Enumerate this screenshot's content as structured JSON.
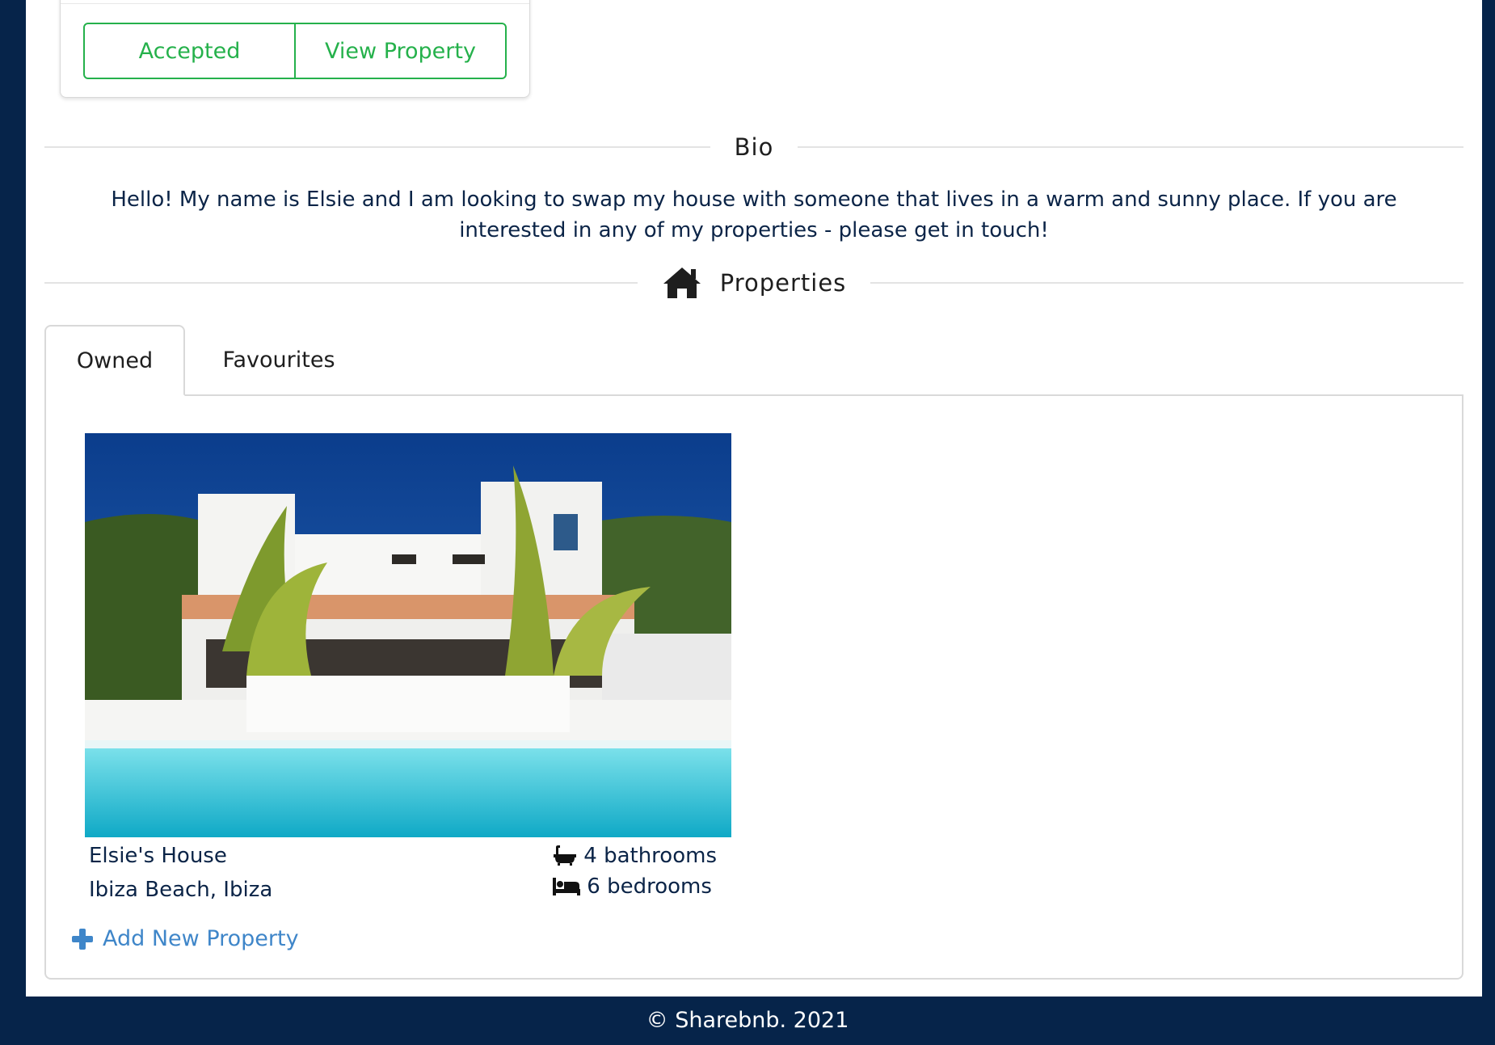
{
  "request_card": {
    "accepted_label": "Accepted",
    "view_property_label": "View Property"
  },
  "bio": {
    "heading": "Bio",
    "text": "Hello! My name is Elsie and I am looking to swap my house with someone that lives in a warm and sunny place. If you are interested in any of my properties - please get in touch!"
  },
  "properties": {
    "heading": "Properties",
    "heading_icon": "home-icon",
    "tabs": [
      {
        "label": "Owned",
        "active": true
      },
      {
        "label": "Favourites",
        "active": false
      }
    ],
    "owned": [
      {
        "name": "Elsie's House",
        "location": "Ibiza Beach, Ibiza",
        "bathrooms": "4 bathrooms",
        "bedrooms": "6 bedrooms",
        "bathroom_icon": "bath-icon",
        "bedroom_icon": "bed-icon"
      }
    ],
    "add_label": "Add New Property"
  },
  "footer": {
    "text": "© Sharebnb. 2021"
  },
  "colors": {
    "navy": "#06244a",
    "green": "#25b14b",
    "link_blue": "#3f86c9"
  }
}
